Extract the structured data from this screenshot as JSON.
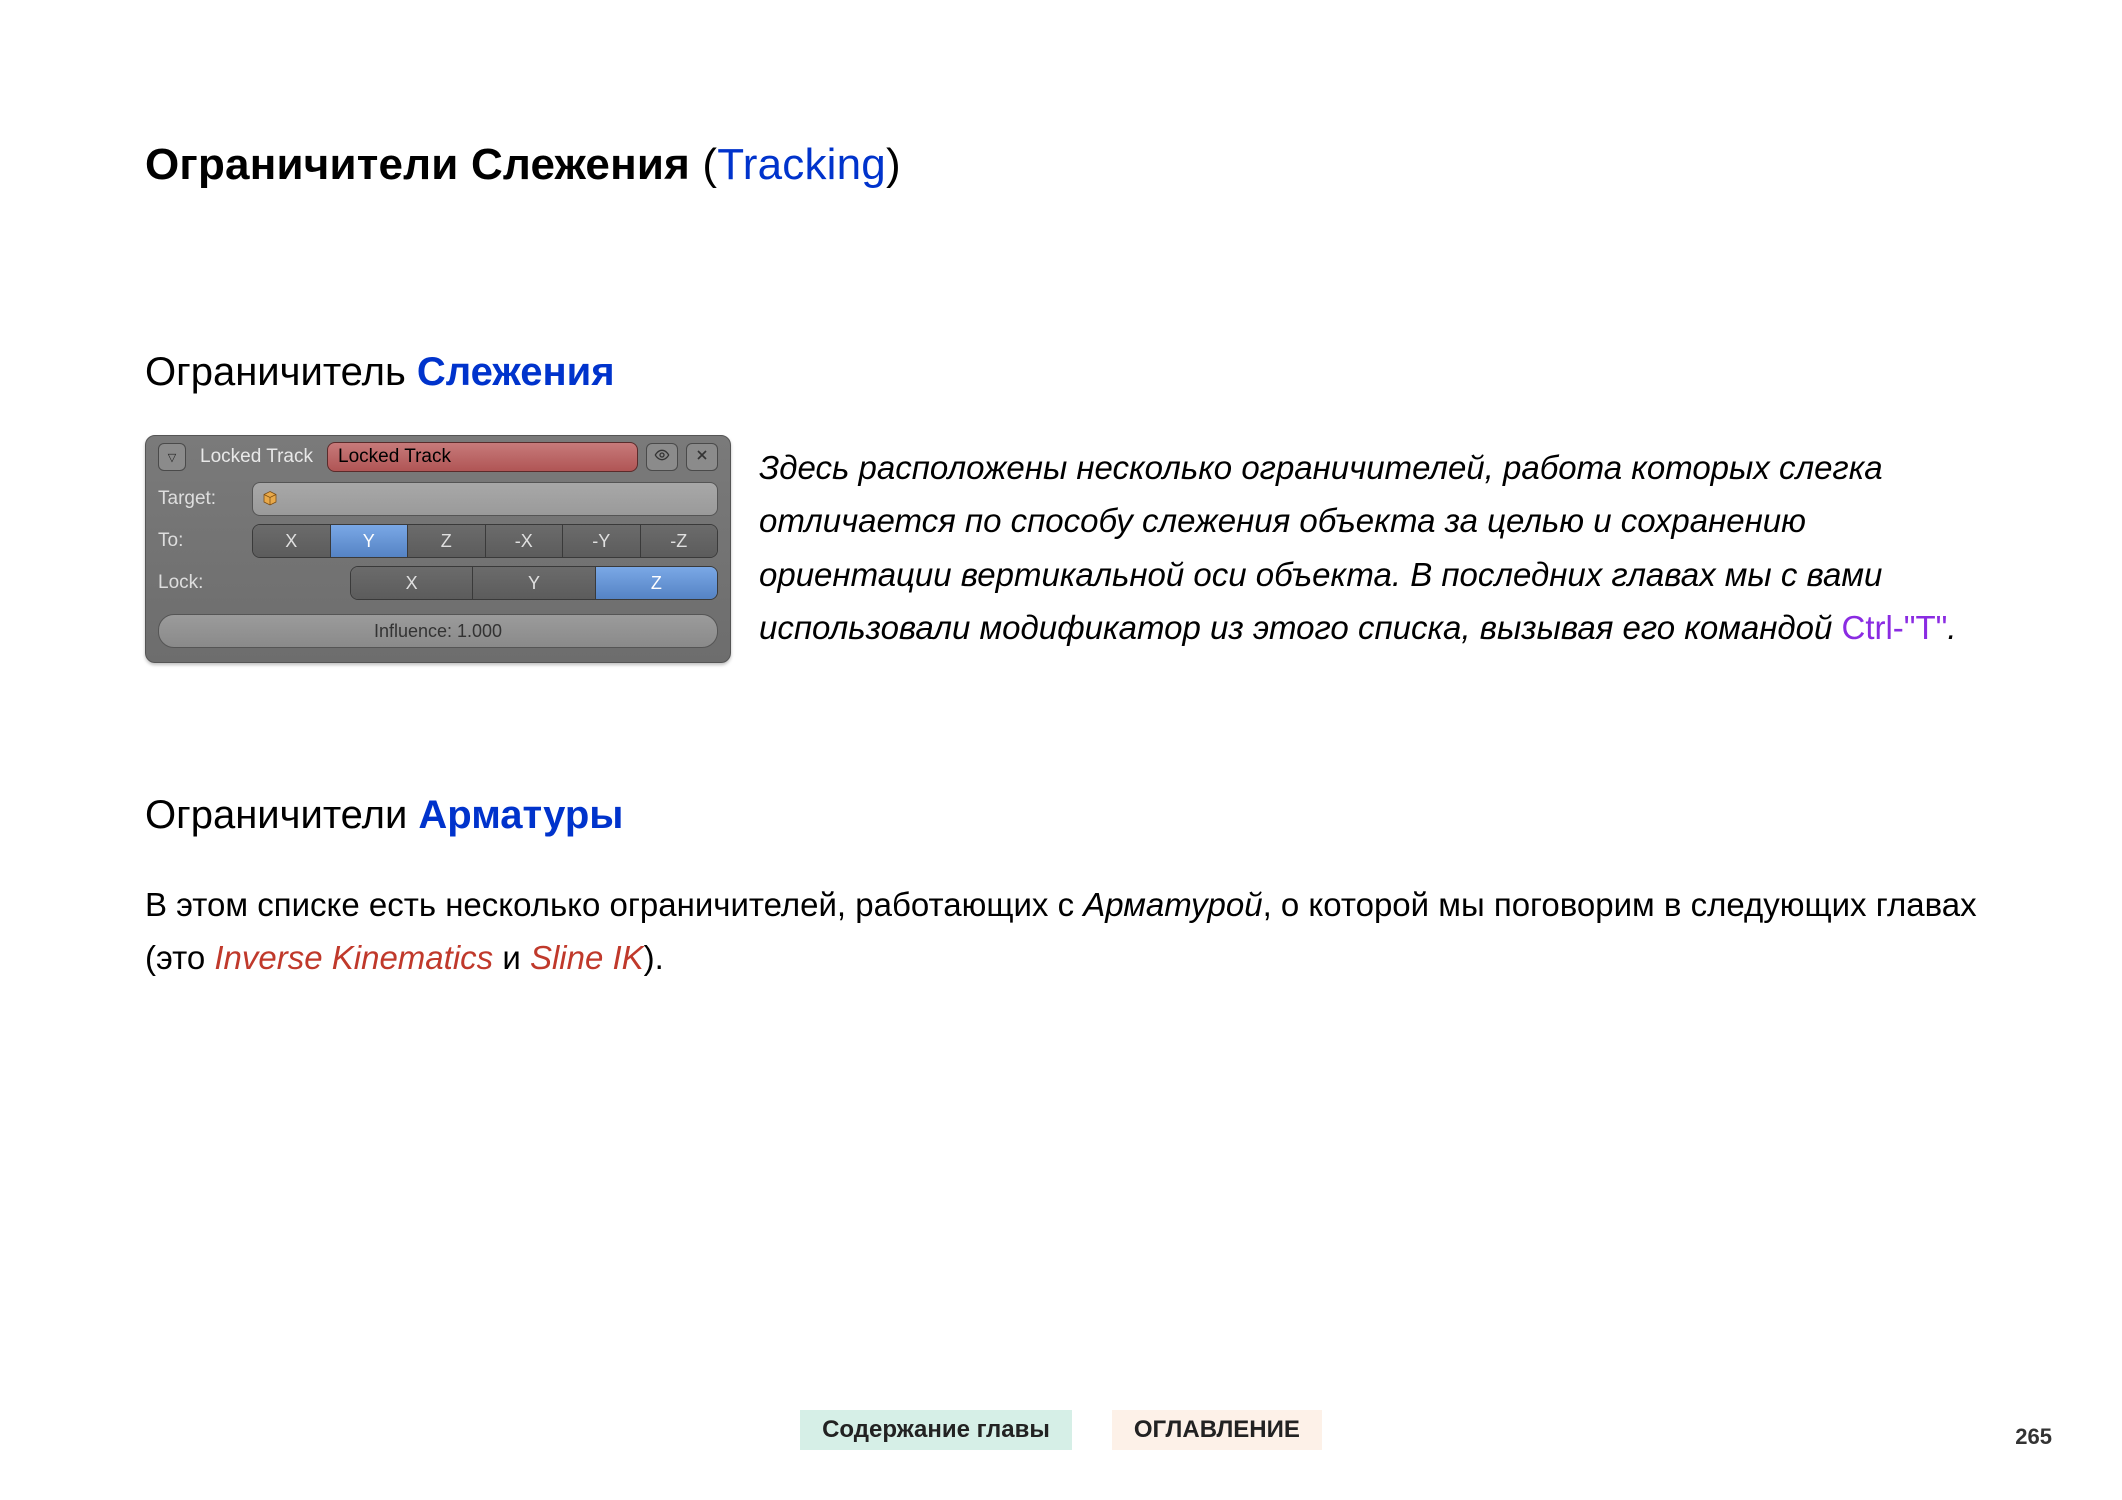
{
  "heading": {
    "part1": "Ограничители Слежения ",
    "paren_open": "(",
    "tracking": "Tracking",
    "paren_close": ")"
  },
  "section1": {
    "title_prefix": "Ограничитель ",
    "title_highlight": "Слежения",
    "para_main": "Здесь расположены несколько ограничителей, работа которых слегка отличается по способу слежения объекта за целью и сохранению ориентации вертикальной оси объекта. В последних главах мы с вами использовали модификатор из этого списка, вызывая его командой ",
    "para_cmd": "Ctrl-\"T\"",
    "para_tail": "."
  },
  "panel": {
    "header_label": "Locked Track",
    "name_value": "Locked Track",
    "target_label": "Target:",
    "to_label": "To:",
    "lock_label": "Lock:",
    "to_axes": [
      "X",
      "Y",
      "Z",
      "-X",
      "-Y",
      "-Z"
    ],
    "to_selected_index": 1,
    "lock_axes": [
      "X",
      "Y",
      "Z"
    ],
    "lock_selected_index": 2,
    "influence_label": "Influence: 1.000"
  },
  "section2": {
    "title_prefix": "Ограничители ",
    "title_highlight": "Арматуры",
    "p_a": "В этом списке есть несколько ограничителей, работающих с ",
    "p_arm": "Арматурой",
    "p_b": ", о которой мы поговорим в следующих главах (это ",
    "p_ik": "Inverse Kinematics",
    "p_and": " и ",
    "p_sline": "Sline IK",
    "p_tail": ")."
  },
  "footer": {
    "chapter": "Содержание главы",
    "toc": "ОГЛАВЛЕНИЕ",
    "page": "265"
  }
}
